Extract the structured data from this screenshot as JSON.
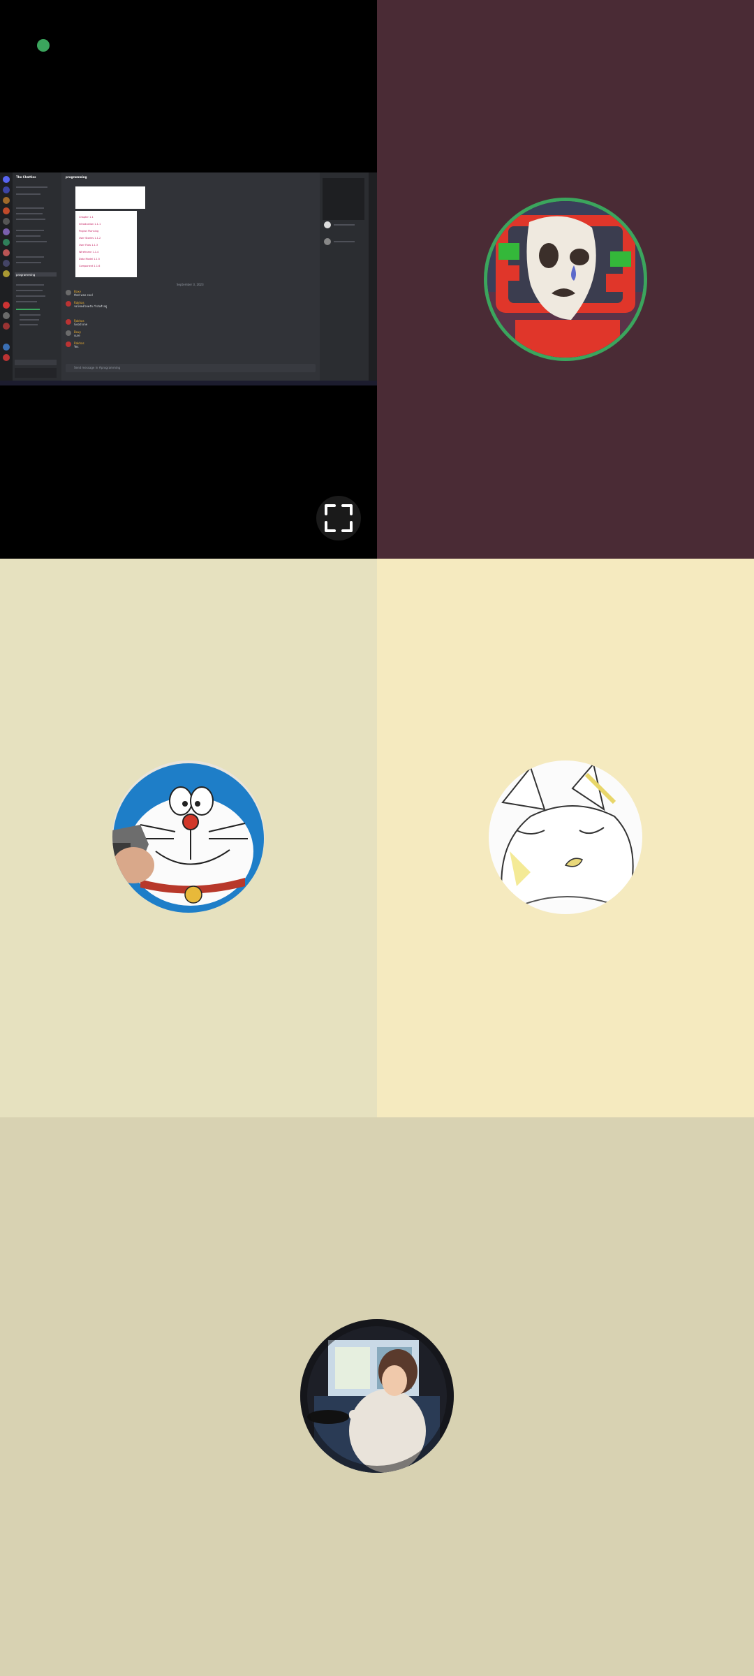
{
  "screen_share": {
    "server_name": "The Chatties",
    "channel_name": "programming",
    "message_placeholder": "Send message in #programming",
    "date_divider": "September 3, 2023",
    "messages": [
      {
        "author": "Baxy",
        "text": "that was cool"
      },
      {
        "author": "Rakhas",
        "text": "ขอโทษด้วยครับ กำลังทำอยู่"
      },
      {
        "author": "Rakhas",
        "text": "Good one"
      },
      {
        "author": "Baxy",
        "text": "sure"
      },
      {
        "author": "Rakhas",
        "text": "Yes"
      }
    ],
    "paper_lines": [
      "Chapter 1.1",
      "Introduction 1.1.1",
      "Project Planning",
      "User Stories 1.1.2",
      "User Flow 1.1.3",
      "Wireframe 1.1.4",
      "Data Model 1.1.5",
      "Component 1.1.6"
    ]
  },
  "tiles": [
    {
      "name": "screen-share",
      "live": true
    },
    {
      "name": "mask-avatar",
      "speaking": true
    },
    {
      "name": "doraemon-avatar"
    },
    {
      "name": "cat-avatar"
    },
    {
      "name": "girl-driving-avatar"
    }
  ],
  "colors": {
    "speaking_ring": "#3ba55d",
    "tile_mask_bg": "#4a2b35",
    "tile_dora_bg": "#e6e1bf",
    "tile_cat_bg": "#f5eabf",
    "tile_girl_bg": "#d8d2b2"
  },
  "icons": {
    "fullscreen": "fullscreen-icon",
    "live_indicator": "live-dot-icon"
  }
}
